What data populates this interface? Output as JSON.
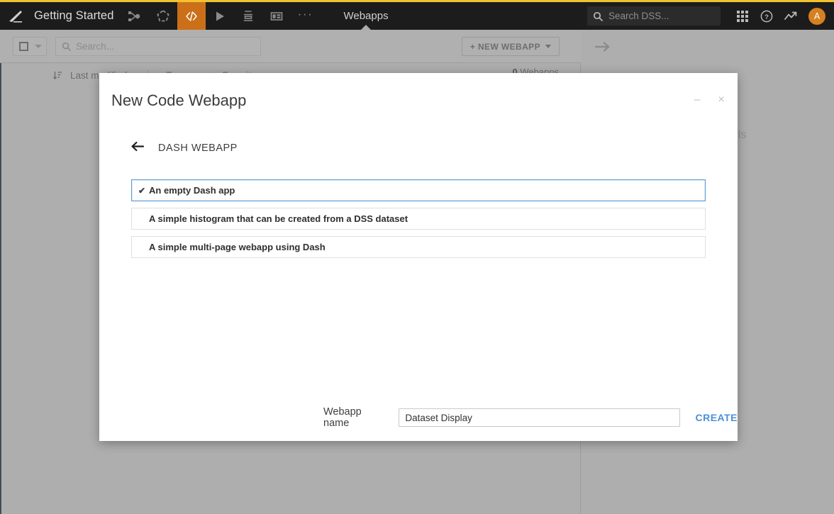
{
  "topbar": {
    "logo_icon": "dataiku-logo-icon",
    "project_name": "Getting Started",
    "icons": [
      {
        "name": "flow-icon",
        "label": "Flow"
      },
      {
        "name": "recipe-icon",
        "label": "Recipes"
      },
      {
        "name": "code-icon",
        "label": "Code",
        "active": true
      },
      {
        "name": "run-icon",
        "label": "Jobs"
      },
      {
        "name": "lab-icon",
        "label": "Lab"
      },
      {
        "name": "dashboard-icon",
        "label": "Dashboards"
      }
    ],
    "more_label": "···",
    "active_tab": "Webapps",
    "search": {
      "placeholder": "Search DSS...",
      "value": "",
      "icon": "search-icon"
    },
    "apps_icon": "apps-grid-icon",
    "help_icon": "help-circle-icon",
    "activity_icon": "trending-up-icon",
    "avatar_initial": "A"
  },
  "list_toolbar": {
    "select_all_icon": "checkbox-icon",
    "select_all_caret": "chevron-down-icon",
    "search": {
      "placeholder": "Search...",
      "value": "",
      "icon": "search-icon"
    },
    "new_webapp_label": "+ NEW WEBAPP",
    "new_webapp_caret": "chevron-down-icon"
  },
  "filters": {
    "sort_icon": "sort-icon",
    "sort_label": "Last modified",
    "tags_label": "Tags",
    "favorites_label": "Favorites",
    "star_icon": "star-icon",
    "count_number": "0",
    "count_label": "Webapps"
  },
  "right_panel": {
    "collapse_icon": "arrow-right-icon",
    "empty_text": "w details"
  },
  "modal": {
    "title": "New Code Webapp",
    "minimize_icon": "minimize-icon",
    "minimize_glyph": "–",
    "close_icon": "close-icon",
    "close_glyph": "×",
    "back_icon": "arrow-left-icon",
    "section_label": "DASH WEBAPP",
    "options": [
      {
        "label": "An empty Dash app",
        "selected": true,
        "check_glyph": "✔"
      },
      {
        "label": "A simple histogram that can be created from a DSS dataset",
        "selected": false
      },
      {
        "label": "A simple multi-page webapp using Dash",
        "selected": false
      }
    ],
    "name_label": "Webapp name",
    "name_value": "Dataset Display",
    "name_placeholder": "",
    "create_label": "CREATE"
  },
  "colors": {
    "topbar_bg": "#1c1c1c",
    "topbar_accent_line": "#f2c230",
    "active_icon_bg": "#cb7019",
    "avatar_bg": "#d68021",
    "page_dim_bg": "#aeaeae",
    "selected_border": "#5b9bd5",
    "create_link": "#4a90d9",
    "star": "#d4a52a"
  }
}
